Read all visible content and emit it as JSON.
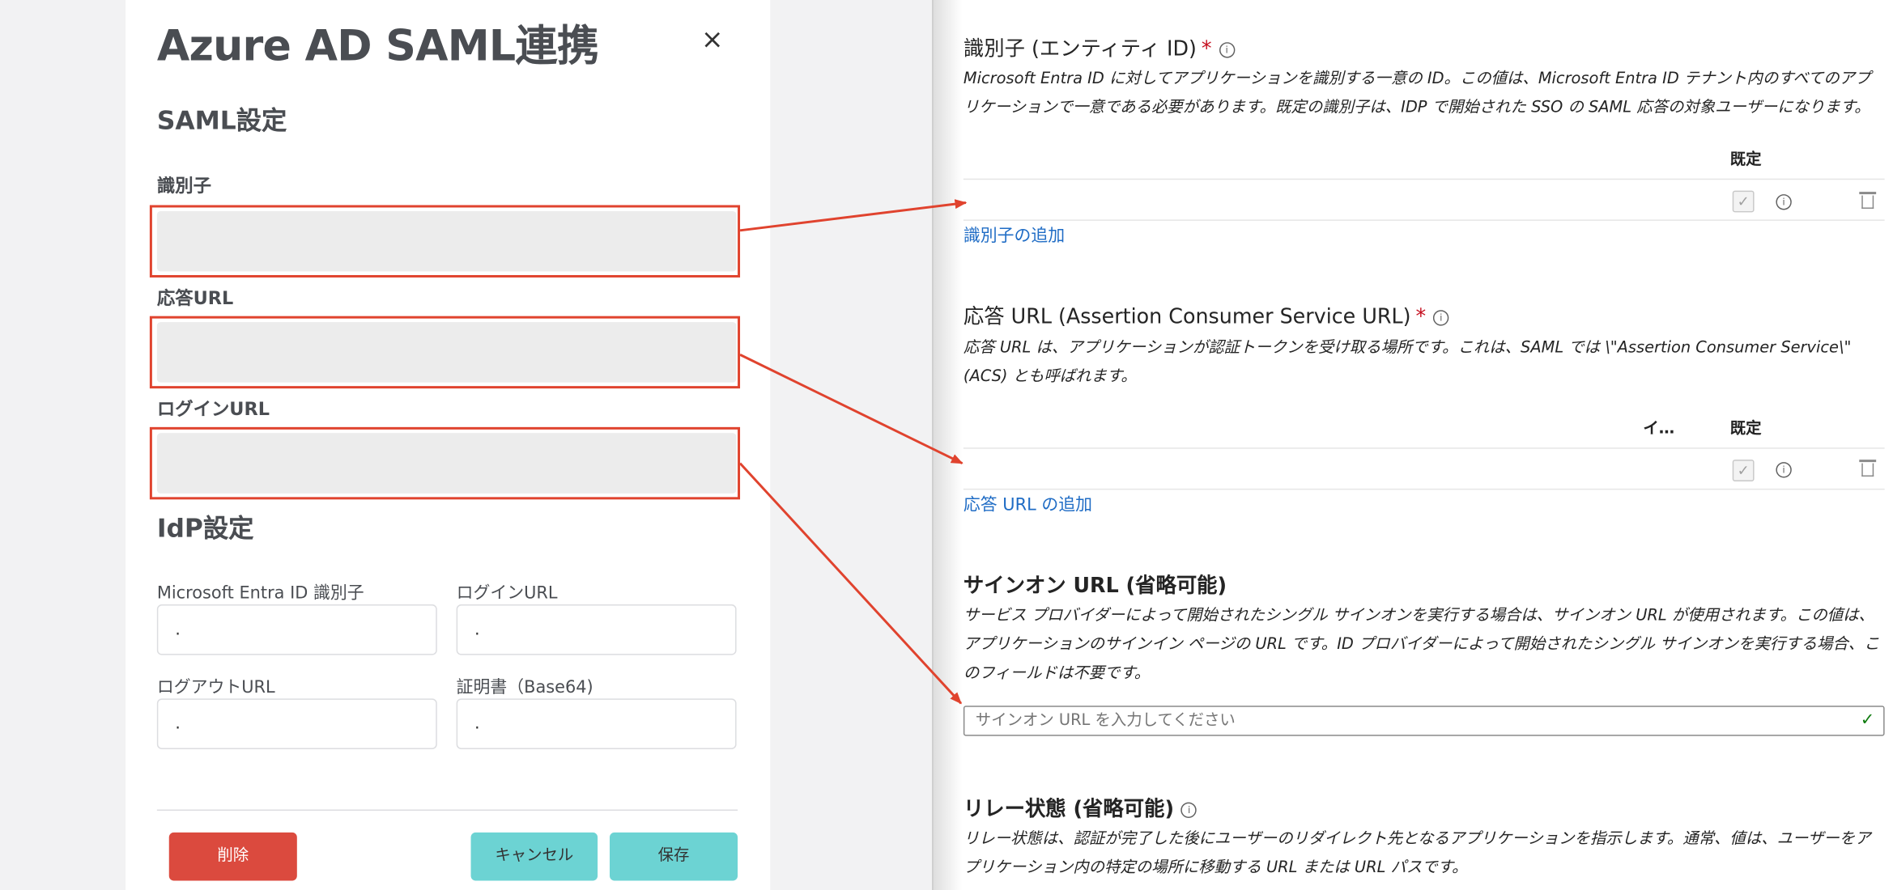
{
  "colors": {
    "annotation_red": "#e0432e",
    "delete_button": "#db4a3e",
    "teal_button": "#6cd3d3",
    "azure_link": "#1f6cc5",
    "required_star": "#c50f1f"
  },
  "modal": {
    "title": "Azure AD SAML連携",
    "close_icon": "×",
    "saml_section": {
      "heading": "SAML設定",
      "identifier_label": "識別子",
      "reply_url_label": "応答URL",
      "login_url_label": "ログインURL"
    },
    "idp_section": {
      "heading": "IdP設定",
      "entra_id_label": "Microsoft Entra ID 識別子",
      "entra_id_value": ".",
      "login_url_label": "ログインURL",
      "login_url_value": ".",
      "logout_url_label": "ログアウトURL",
      "logout_url_value": ".",
      "certificate_label": "証明書（Base64)",
      "certificate_value": "."
    },
    "buttons": {
      "delete": "削除",
      "cancel": "キャンセル",
      "save": "保存"
    }
  },
  "azure": {
    "identifier": {
      "heading": "識別子 (エンティティ ID)",
      "required": "*",
      "description": "Microsoft Entra ID に対してアプリケーションを識別する一意の ID。この値は、Microsoft Entra ID テナント内のすべてのアプリケーションで一意である必要があります。既定の識別子は、IDP で開始された SSO の SAML 応答の対象ユーザーになります。",
      "col_default": "既定",
      "add_link": "識別子の追加"
    },
    "reply_url": {
      "heading": "応答 URL (Assertion Consumer Service URL)",
      "required": "*",
      "description": "応答 URL は、アプリケーションが認証トークンを受け取る場所です。これは、SAML では \\\"Assertion Consumer Service\\\" (ACS) とも呼ばれます。",
      "col_index": "イ…",
      "col_default": "既定",
      "add_link": "応答 URL の追加"
    },
    "sign_on_url": {
      "heading": "サインオン URL (省略可能)",
      "description": "サービス プロバイダーによって開始されたシングル サインオンを実行する場合は、サインオン URL が使用されます。この値は、アプリケーションのサインイン ページの URL です。ID プロバイダーによって開始されたシングル サインオンを実行する場合、このフィールドは不要です。",
      "placeholder": "サインオン URL を入力してください"
    },
    "relay_state": {
      "heading": "リレー状態 (省略可能)",
      "description": "リレー状態は、認証が完了した後にユーザーのリダイレクト先となるアプリケーションを指示します。通常、値は、ユーザーをアプリケーション内の特定の場所に移動する URL または URL パスです。"
    }
  }
}
